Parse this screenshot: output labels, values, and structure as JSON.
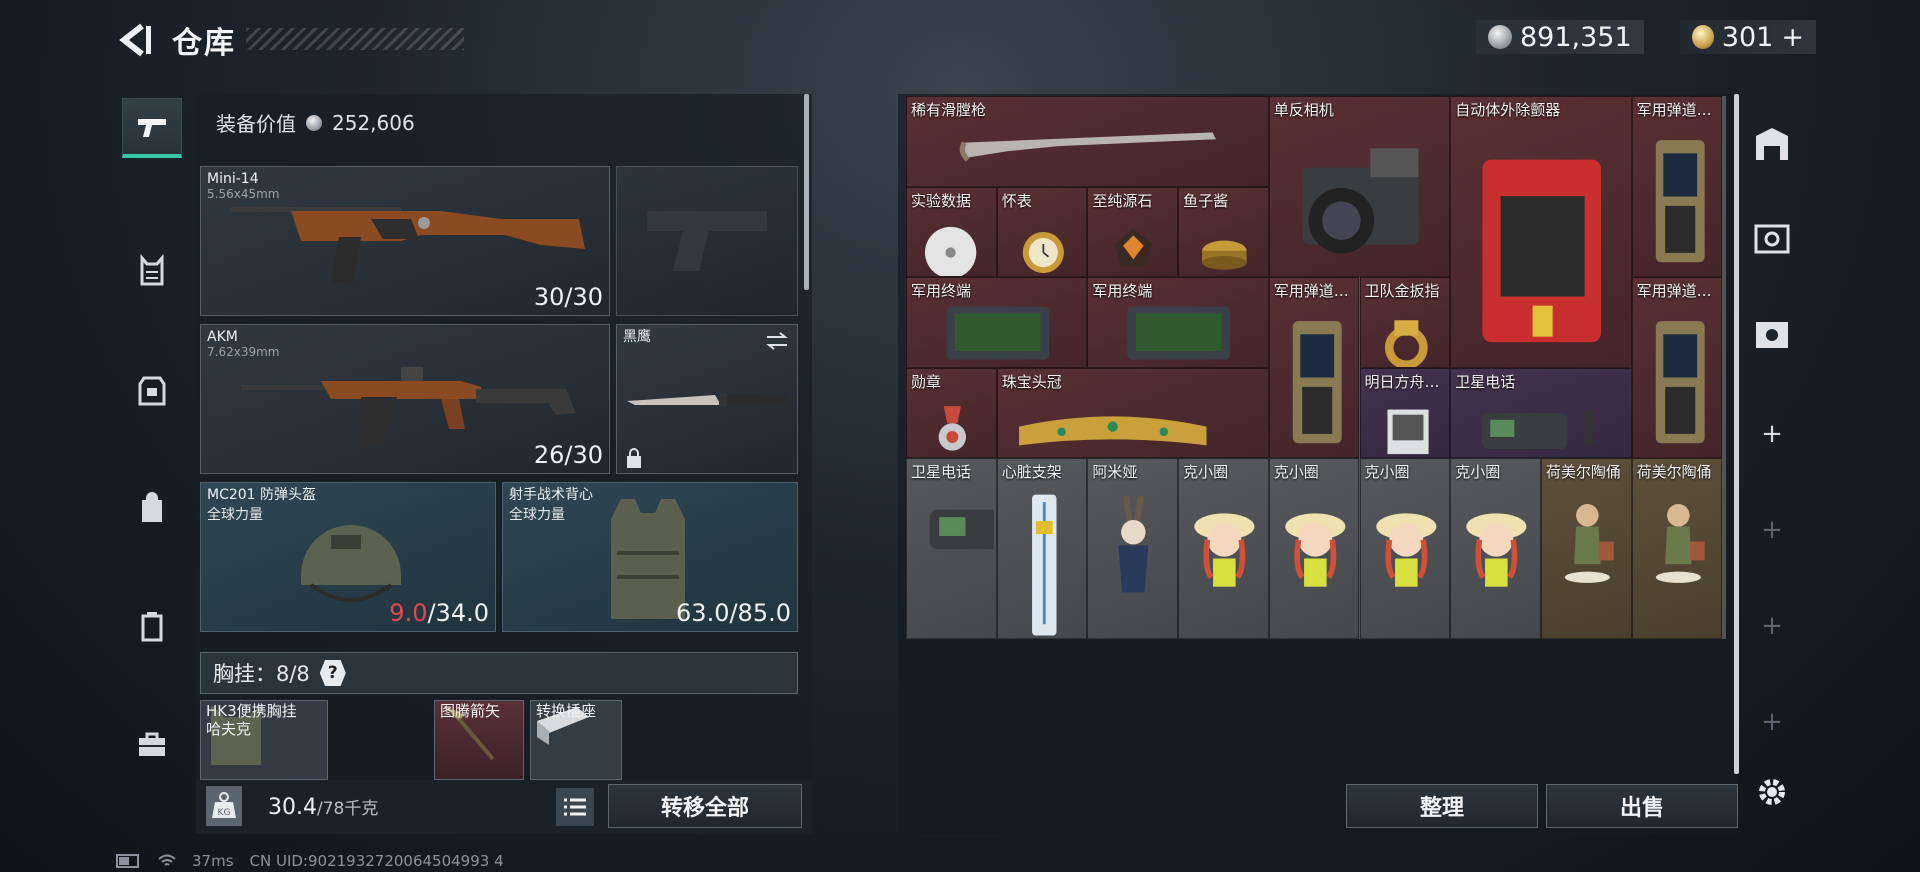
{
  "header": {
    "title": "仓库"
  },
  "currency": {
    "silver": "891,351",
    "gold": "301",
    "gold_add": "+"
  },
  "equipment": {
    "value_label": "装备价值",
    "value": "252,606",
    "primary": {
      "name": "Mini-14",
      "caliber": "5.56x45mm",
      "ammo": "30/30"
    },
    "secondary": {
      "name": "AKM",
      "caliber": "7.62x39mm",
      "ammo": "26/30"
    },
    "melee": {
      "name": "黑鹰"
    },
    "helmet": {
      "name": "MC201 防弹头盔",
      "brand": "全球力量",
      "durability_current": "9.0",
      "durability_max": "/34.0"
    },
    "armor": {
      "name": "射手战术背心",
      "brand": "全球力量",
      "durability": "63.0/85.0"
    },
    "chest_rig": {
      "label": "胸挂：8/8",
      "help": "?"
    },
    "rig_items": [
      {
        "name": "HK3便携胸挂",
        "sub": "哈夫克"
      },
      {
        "name": "图腾箭矢"
      },
      {
        "name": "转换插座"
      }
    ]
  },
  "bottom": {
    "weight": "30.4",
    "weight_max": "/78千克",
    "transfer_all": "转移全部",
    "sort": "整理",
    "sell": "出售"
  },
  "storage": {
    "items": [
      {
        "label": "稀有滑膛枪",
        "rarity": "red",
        "icon": "musket-icon"
      },
      {
        "label": "单反相机",
        "rarity": "red",
        "icon": "camera-icon"
      },
      {
        "label": "自动体外除颤器",
        "rarity": "red",
        "icon": "aed-icon"
      },
      {
        "label": "军用弹道…",
        "rarity": "red",
        "icon": "ballistic-computer-icon"
      },
      {
        "label": "实验数据",
        "rarity": "red",
        "icon": "disc-icon"
      },
      {
        "label": "怀表",
        "rarity": "red",
        "icon": "pocket-watch-icon"
      },
      {
        "label": "至纯源石",
        "rarity": "red",
        "icon": "gem-icon"
      },
      {
        "label": "鱼子酱",
        "rarity": "red",
        "icon": "caviar-icon"
      },
      {
        "label": "军用终端",
        "rarity": "red",
        "icon": "terminal-icon"
      },
      {
        "label": "军用终端",
        "rarity": "red",
        "icon": "terminal-icon"
      },
      {
        "label": "军用弹道…",
        "rarity": "red",
        "icon": "ballistic-computer-icon"
      },
      {
        "label": "卫队金扳指",
        "rarity": "red",
        "icon": "gold-ring-icon"
      },
      {
        "label": "军用弹道…",
        "rarity": "red",
        "icon": "ballistic-computer-icon"
      },
      {
        "label": "勋章",
        "rarity": "red",
        "icon": "medal-icon"
      },
      {
        "label": "珠宝头冠",
        "rarity": "red",
        "icon": "crown-icon"
      },
      {
        "label": "明日方舟…",
        "rarity": "purple",
        "icon": "cd-case-icon"
      },
      {
        "label": "卫星电话",
        "rarity": "purple",
        "icon": "sat-phone-icon"
      },
      {
        "label": "卫星电话",
        "rarity": "gray",
        "icon": "sat-phone-icon"
      },
      {
        "label": "心脏支架",
        "rarity": "gray",
        "icon": "stent-icon"
      },
      {
        "label": "阿米娅",
        "rarity": "gray",
        "icon": "figure-icon"
      },
      {
        "label": "克小圈",
        "rarity": "gray",
        "icon": "doll-icon"
      },
      {
        "label": "克小圈",
        "rarity": "gray",
        "icon": "doll-icon"
      },
      {
        "label": "克小圈",
        "rarity": "gray",
        "icon": "doll-icon"
      },
      {
        "label": "克小圈",
        "rarity": "gray",
        "icon": "doll-icon"
      },
      {
        "label": "荷美尔陶俑",
        "rarity": "gold",
        "icon": "figurine-icon"
      },
      {
        "label": "荷美尔陶俑",
        "rarity": "gold",
        "icon": "figurine-icon"
      }
    ]
  },
  "status": {
    "ping": "37ms",
    "uid": "CN UID:9021932720064504993 4"
  }
}
